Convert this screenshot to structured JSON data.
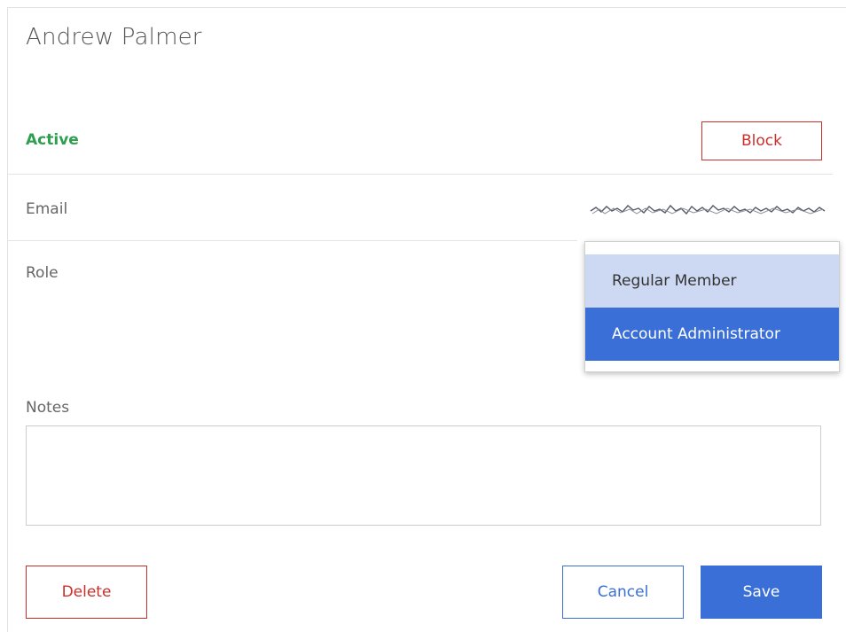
{
  "user": {
    "name": "Andrew Palmer",
    "status": "Active"
  },
  "actions": {
    "block_label": "Block",
    "delete_label": "Delete",
    "cancel_label": "Cancel",
    "save_label": "Save"
  },
  "fields": {
    "email_label": "Email",
    "role_label": "Role",
    "notes_label": "Notes",
    "notes_value": ""
  },
  "role_dropdown": {
    "options": [
      {
        "label": "Regular Member",
        "state": "hover"
      },
      {
        "label": "Account Administrator",
        "state": "selected"
      }
    ]
  },
  "colors": {
    "active_green": "#2e9e4f",
    "danger_red": "#c9302c",
    "primary_blue": "#3a6fd8",
    "hover_blue": "#cdd9f3"
  }
}
